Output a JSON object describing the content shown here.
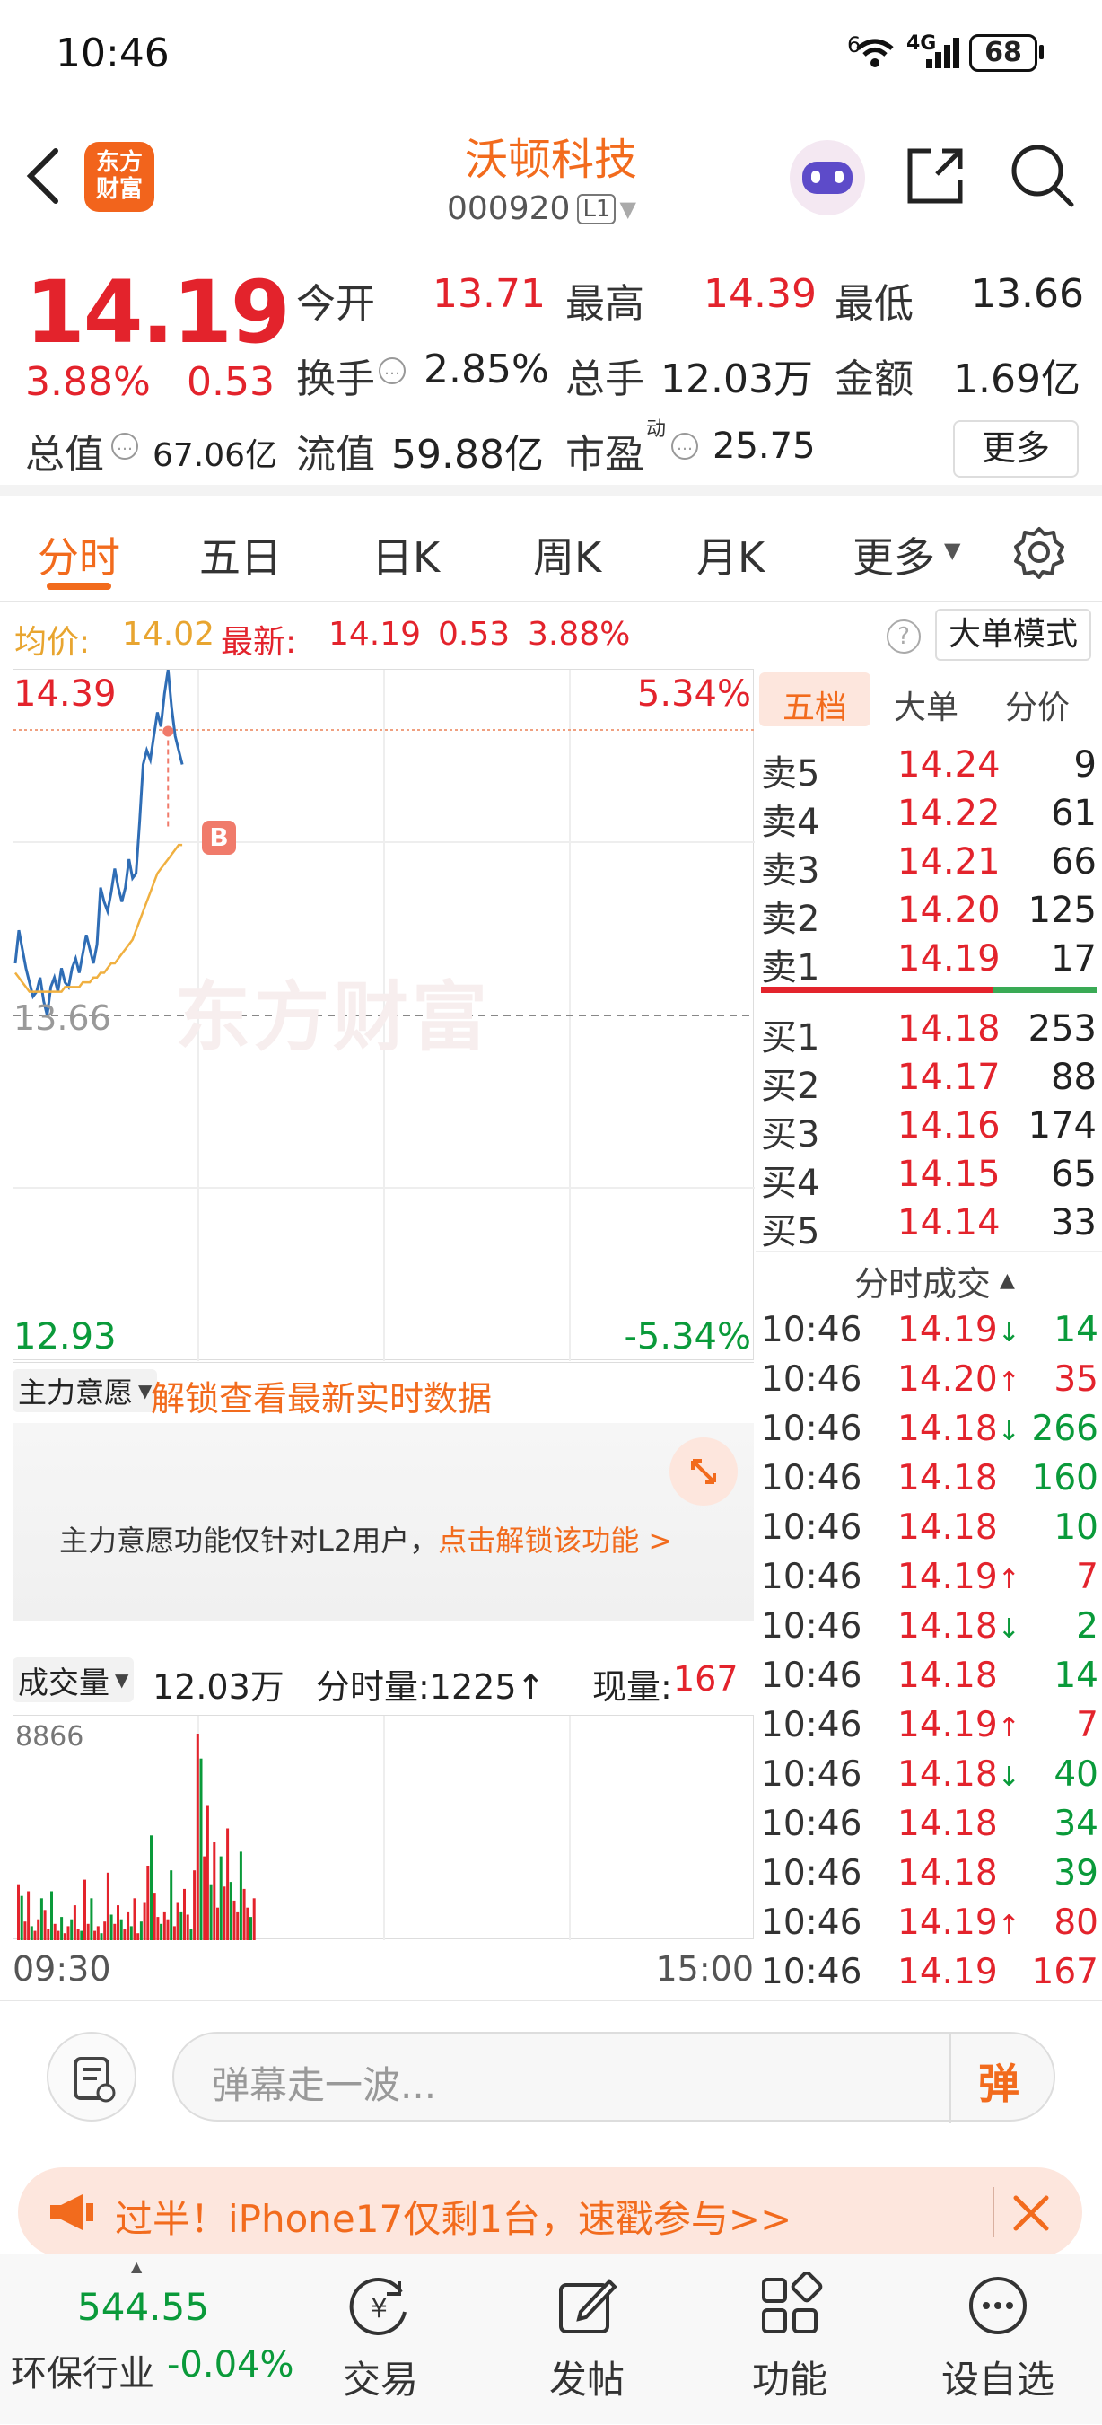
{
  "status": {
    "time": "10:46",
    "battery": "68",
    "signal": "4G",
    "wifi_badge": "6"
  },
  "header": {
    "brand_logo": "东方\n财富",
    "stock_name": "沃顿科技",
    "stock_code": "000920",
    "level_badge": "L1"
  },
  "quote": {
    "price": "14.19",
    "pct": "3.88%",
    "chg": "0.53",
    "open_label": "今开",
    "open": "13.71",
    "high_label": "最高",
    "high": "14.39",
    "low_label": "最低",
    "low": "13.66",
    "turnover_label": "换手",
    "turnover": "2.85%",
    "volume_label": "总手",
    "volume": "12.03万",
    "amount_label": "金额",
    "amount": "1.69亿",
    "mktcap_label": "总值",
    "mktcap": "67.06亿",
    "float_label": "流值",
    "float": "59.88亿",
    "pe_label": "市盈",
    "pe_sup": "动",
    "pe": "25.75",
    "more_button": "更多"
  },
  "tabs": [
    "分时",
    "五日",
    "日K",
    "周K",
    "月K",
    "更多"
  ],
  "pricebar": {
    "avg_label": "均价:",
    "avg": "14.02",
    "latest_label": "最新:",
    "latest": "14.19",
    "chg": "0.53",
    "pct": "3.88%",
    "mode_button": "大单模式"
  },
  "chart": {
    "top_price": "14.39",
    "top_pct": "5.34%",
    "mid_price": "13.66",
    "bottom_price": "12.93",
    "bottom_pct": "-5.34%",
    "marker": "B",
    "watermark": "东方财富"
  },
  "orderbook": {
    "tabs": [
      "五档",
      "大单",
      "分价"
    ],
    "sells": [
      {
        "label": "卖5",
        "price": "14.24",
        "qty": "9"
      },
      {
        "label": "卖4",
        "price": "14.22",
        "qty": "61"
      },
      {
        "label": "卖3",
        "price": "14.21",
        "qty": "66"
      },
      {
        "label": "卖2",
        "price": "14.20",
        "qty": "125"
      },
      {
        "label": "卖1",
        "price": "14.19",
        "qty": "17"
      }
    ],
    "buys": [
      {
        "label": "买1",
        "price": "14.18",
        "qty": "253"
      },
      {
        "label": "买2",
        "price": "14.17",
        "qty": "88"
      },
      {
        "label": "买3",
        "price": "14.16",
        "qty": "174"
      },
      {
        "label": "买4",
        "price": "14.15",
        "qty": "65"
      },
      {
        "label": "买5",
        "price": "14.14",
        "qty": "33"
      }
    ],
    "ticks_title": "分时成交",
    "ticks": [
      {
        "time": "10:46",
        "price": "14.19",
        "arrow": "↓",
        "qty": "14",
        "pc": "red",
        "qc": "green"
      },
      {
        "time": "10:46",
        "price": "14.20",
        "arrow": "↑",
        "qty": "35",
        "pc": "red",
        "qc": "red"
      },
      {
        "time": "10:46",
        "price": "14.18",
        "arrow": "↓",
        "qty": "266",
        "pc": "red",
        "qc": "green"
      },
      {
        "time": "10:46",
        "price": "14.18",
        "arrow": "",
        "qty": "160",
        "pc": "red",
        "qc": "green"
      },
      {
        "time": "10:46",
        "price": "14.18",
        "arrow": "",
        "qty": "10",
        "pc": "red",
        "qc": "green"
      },
      {
        "time": "10:46",
        "price": "14.19",
        "arrow": "↑",
        "qty": "7",
        "pc": "red",
        "qc": "red"
      },
      {
        "time": "10:46",
        "price": "14.18",
        "arrow": "↓",
        "qty": "2",
        "pc": "red",
        "qc": "green"
      },
      {
        "time": "10:46",
        "price": "14.18",
        "arrow": "",
        "qty": "14",
        "pc": "red",
        "qc": "green"
      },
      {
        "time": "10:46",
        "price": "14.19",
        "arrow": "↑",
        "qty": "7",
        "pc": "red",
        "qc": "red"
      },
      {
        "time": "10:46",
        "price": "14.18",
        "arrow": "↓",
        "qty": "40",
        "pc": "red",
        "qc": "green"
      },
      {
        "time": "10:46",
        "price": "14.18",
        "arrow": "",
        "qty": "34",
        "pc": "red",
        "qc": "green"
      },
      {
        "time": "10:46",
        "price": "14.18",
        "arrow": "",
        "qty": "39",
        "pc": "red",
        "qc": "green"
      },
      {
        "time": "10:46",
        "price": "14.19",
        "arrow": "↑",
        "qty": "80",
        "pc": "red",
        "qc": "red"
      },
      {
        "time": "10:46",
        "price": "14.19",
        "arrow": "",
        "qty": "167",
        "pc": "red",
        "qc": "red"
      }
    ]
  },
  "intent": {
    "selector": "主力意愿",
    "unlock_link": "解锁查看最新实时数据",
    "notice": "主力意愿功能仅针对L2用户，",
    "notice_link": "点击解锁该功能 >"
  },
  "volume": {
    "selector": "成交量",
    "total": "12.03万",
    "tick_label": "分时量:1225↑",
    "current_label": "现量:",
    "current": "167",
    "max": "8866"
  },
  "time_axis": {
    "start": "09:30",
    "end": "15:00"
  },
  "danmu": {
    "placeholder": "弹幕走一波...",
    "send_icon_text": "弹"
  },
  "promo": {
    "text": "过半！iPhone17仅剩1台，速戳参与>>"
  },
  "bottom_nav": {
    "index_value": "544.55",
    "index_name": "环保行业",
    "index_chg": "-0.04%",
    "items": [
      "交易",
      "发帖",
      "功能",
      "设自选"
    ]
  },
  "colors": {
    "up": "#e3232c",
    "down": "#0a9a3a",
    "accent": "#f26b1d",
    "avg_line": "#f0b040",
    "price_line": "#2f6db5"
  },
  "chart_data": {
    "type": "line",
    "title": "",
    "xlabel": "",
    "ylabel": "",
    "x_ticks": [
      "09:30",
      "15:00"
    ],
    "ylim": [
      12.93,
      14.39
    ],
    "series": [
      {
        "name": "",
        "values": [
          13.77,
          13.84,
          13.8,
          13.76,
          13.73,
          13.7,
          13.71,
          13.74,
          13.69,
          13.66,
          13.72,
          13.74,
          13.71,
          13.76,
          13.73,
          13.72,
          13.76,
          13.78,
          13.75,
          13.79,
          13.83,
          13.8,
          13.77,
          13.81,
          13.93,
          13.9,
          13.88,
          13.92,
          13.97,
          13.93,
          13.9,
          13.93,
          13.99,
          13.95,
          13.96,
          14.07,
          14.19,
          14.22,
          14.2,
          14.25,
          14.3,
          14.27,
          14.34,
          14.39,
          14.31,
          14.25,
          14.22,
          14.19
        ]
      },
      {
        "name": "",
        "values": [
          13.75,
          13.74,
          13.73,
          13.72,
          13.71,
          13.71,
          13.71,
          13.71,
          13.71,
          13.71,
          13.71,
          13.71,
          13.71,
          13.71,
          13.72,
          13.72,
          13.72,
          13.72,
          13.72,
          13.73,
          13.73,
          13.73,
          13.74,
          13.74,
          13.75,
          13.75,
          13.76,
          13.77,
          13.77,
          13.78,
          13.79,
          13.8,
          13.81,
          13.82,
          13.84,
          13.86,
          13.88,
          13.9,
          13.92,
          13.94,
          13.96,
          13.97,
          13.98,
          13.99,
          14.0,
          14.01,
          14.02,
          14.02
        ]
      }
    ],
    "volume_max": 8866,
    "volumes": [
      2400,
      1900,
      800,
      2100,
      600,
      400,
      900,
      1800,
      1300,
      500,
      2100,
      700,
      400,
      1000,
      300,
      600,
      900,
      1500,
      500,
      400,
      2600,
      700,
      1800,
      400,
      600,
      300,
      800,
      2900,
      1100,
      700,
      1500,
      900,
      500,
      1200,
      600,
      1800,
      300,
      800,
      1600,
      3200,
      4500,
      2000,
      1000,
      700,
      1200,
      900,
      3000,
      600,
      1600,
      1200,
      2200,
      1100,
      500,
      3000,
      8866,
      7800,
      3600,
      5800,
      2400,
      4200,
      1400,
      3600,
      2300,
      4800,
      2500,
      1700,
      1200,
      3800,
      2200,
      1400,
      1000,
      1800
    ]
  }
}
